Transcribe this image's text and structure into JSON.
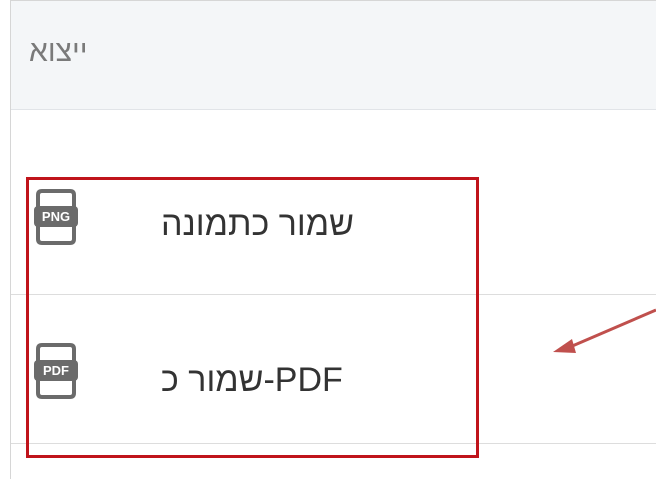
{
  "panel": {
    "title": "ייצוא"
  },
  "menu": {
    "items": [
      {
        "label": "שמור כתמונה",
        "icon": "png-file-icon",
        "badge": "PNG"
      },
      {
        "label": "PDF-שמור כ",
        "icon": "pdf-file-icon",
        "badge": "PDF"
      }
    ]
  },
  "annotation": {
    "highlight_color": "#c0141b",
    "arrow_color": "#c0504d"
  }
}
